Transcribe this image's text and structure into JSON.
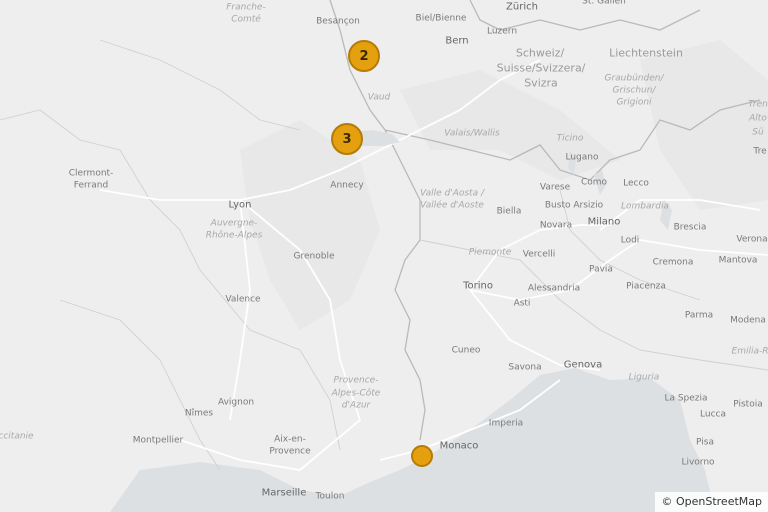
{
  "map": {
    "labels": [
      {
        "id": "franche-comte-1",
        "text": "Franche-",
        "kind": "region"
      },
      {
        "id": "franche-comte-2",
        "text": "Comté",
        "kind": "region"
      },
      {
        "id": "besancon",
        "text": "Besançon",
        "kind": "city"
      },
      {
        "id": "biel",
        "text": "Biel/Bienne",
        "kind": "city"
      },
      {
        "id": "bern",
        "text": "Bern",
        "kind": "big"
      },
      {
        "id": "zurich",
        "text": "Zürich",
        "kind": "big"
      },
      {
        "id": "st-gallen",
        "text": "St. Gallen",
        "kind": "city"
      },
      {
        "id": "luzern",
        "text": "Luzern",
        "kind": "city"
      },
      {
        "id": "liechtenstein",
        "text": "Liechtenstein",
        "kind": "country"
      },
      {
        "id": "schweiz-1",
        "text": "Schweiz/",
        "kind": "country"
      },
      {
        "id": "schweiz-2",
        "text": "Suisse/Svizzera/",
        "kind": "country"
      },
      {
        "id": "schweiz-3",
        "text": "Svizra",
        "kind": "country"
      },
      {
        "id": "graubunden-1",
        "text": "Graubünden/",
        "kind": "region"
      },
      {
        "id": "graubunden-2",
        "text": "Grischun/",
        "kind": "region"
      },
      {
        "id": "graubunden-3",
        "text": "Grigioni",
        "kind": "region"
      },
      {
        "id": "vaud",
        "text": "Vaud",
        "kind": "region"
      },
      {
        "id": "valais",
        "text": "Valais/Wallis",
        "kind": "region"
      },
      {
        "id": "ticino",
        "text": "Ticino",
        "kind": "region"
      },
      {
        "id": "trentino-1",
        "text": "Tren",
        "kind": "region"
      },
      {
        "id": "trentino-2",
        "text": "Alto",
        "kind": "region"
      },
      {
        "id": "trentino-3",
        "text": "Sü",
        "kind": "region"
      },
      {
        "id": "trento",
        "text": "Tre",
        "kind": "city"
      },
      {
        "id": "clermont-1",
        "text": "Clermont-",
        "kind": "city"
      },
      {
        "id": "clermont-2",
        "text": "Ferrand",
        "kind": "city"
      },
      {
        "id": "annecy",
        "text": "Annecy",
        "kind": "city"
      },
      {
        "id": "lugano",
        "text": "Lugano",
        "kind": "city"
      },
      {
        "id": "como",
        "text": "Como",
        "kind": "city"
      },
      {
        "id": "lecco",
        "text": "Lecco",
        "kind": "city"
      },
      {
        "id": "varese",
        "text": "Varese",
        "kind": "city"
      },
      {
        "id": "lyon",
        "text": "Lyon",
        "kind": "big"
      },
      {
        "id": "valle-aosta-1",
        "text": "Valle d'Aosta /",
        "kind": "region"
      },
      {
        "id": "valle-aosta-2",
        "text": "Vallée d'Aoste",
        "kind": "region"
      },
      {
        "id": "biella",
        "text": "Biella",
        "kind": "city"
      },
      {
        "id": "busto",
        "text": "Busto Arsizio",
        "kind": "city"
      },
      {
        "id": "lombardia",
        "text": "Lombardia",
        "kind": "region"
      },
      {
        "id": "auvergne-1",
        "text": "Auvergne-",
        "kind": "region"
      },
      {
        "id": "auvergne-2",
        "text": "Rhône-Alpes",
        "kind": "region"
      },
      {
        "id": "novara",
        "text": "Novara",
        "kind": "city"
      },
      {
        "id": "milano",
        "text": "Milano",
        "kind": "big"
      },
      {
        "id": "brescia",
        "text": "Brescia",
        "kind": "city"
      },
      {
        "id": "verona",
        "text": "Verona",
        "kind": "city"
      },
      {
        "id": "lodi",
        "text": "Lodi",
        "kind": "city"
      },
      {
        "id": "grenoble",
        "text": "Grenoble",
        "kind": "city"
      },
      {
        "id": "piemonte",
        "text": "Piemonte",
        "kind": "region"
      },
      {
        "id": "vercelli",
        "text": "Vercelli",
        "kind": "city"
      },
      {
        "id": "cremona",
        "text": "Cremona",
        "kind": "city"
      },
      {
        "id": "mantova",
        "text": "Mantova",
        "kind": "city"
      },
      {
        "id": "pavia",
        "text": "Pavia",
        "kind": "city"
      },
      {
        "id": "torino",
        "text": "Torino",
        "kind": "big"
      },
      {
        "id": "alessandria",
        "text": "Alessandria",
        "kind": "city"
      },
      {
        "id": "piacenza",
        "text": "Piacenza",
        "kind": "city"
      },
      {
        "id": "valence",
        "text": "Valence",
        "kind": "city"
      },
      {
        "id": "asti",
        "text": "Asti",
        "kind": "city"
      },
      {
        "id": "parma",
        "text": "Parma",
        "kind": "city"
      },
      {
        "id": "modena",
        "text": "Modena",
        "kind": "city"
      },
      {
        "id": "emilia",
        "text": "Emilia-R",
        "kind": "region"
      },
      {
        "id": "cuneo",
        "text": "Cuneo",
        "kind": "city"
      },
      {
        "id": "savona",
        "text": "Savona",
        "kind": "city"
      },
      {
        "id": "genova",
        "text": "Genova",
        "kind": "big"
      },
      {
        "id": "provence-1",
        "text": "Provence-",
        "kind": "region"
      },
      {
        "id": "provence-2",
        "text": "Alpes-Côte",
        "kind": "region"
      },
      {
        "id": "provence-3",
        "text": "d'Azur",
        "kind": "region"
      },
      {
        "id": "liguria",
        "text": "Liguria",
        "kind": "region"
      },
      {
        "id": "avignon",
        "text": "Avignon",
        "kind": "city"
      },
      {
        "id": "la-spezia",
        "text": "La Spezia",
        "kind": "city"
      },
      {
        "id": "pistoia",
        "text": "Pistoia",
        "kind": "city"
      },
      {
        "id": "nimes",
        "text": "Nîmes",
        "kind": "city"
      },
      {
        "id": "lucca",
        "text": "Lucca",
        "kind": "city"
      },
      {
        "id": "imperia",
        "text": "Imperia",
        "kind": "city"
      },
      {
        "id": "occitanie",
        "text": "ccitanie",
        "kind": "region"
      },
      {
        "id": "montpellier",
        "text": "Montpellier",
        "kind": "city"
      },
      {
        "id": "aix-1",
        "text": "Aix-en-",
        "kind": "city"
      },
      {
        "id": "aix-2",
        "text": "Provence",
        "kind": "city"
      },
      {
        "id": "monaco",
        "text": "Monaco",
        "kind": "big"
      },
      {
        "id": "pisa",
        "text": "Pisa",
        "kind": "city"
      },
      {
        "id": "livorno",
        "text": "Livorno",
        "kind": "city"
      },
      {
        "id": "marseille",
        "text": "Marseille",
        "kind": "big"
      },
      {
        "id": "toulon",
        "text": "Toulon",
        "kind": "city"
      }
    ],
    "markers": [
      {
        "id": "cluster-2",
        "count": "2",
        "type": "cluster"
      },
      {
        "id": "cluster-3",
        "count": "3",
        "type": "cluster"
      },
      {
        "id": "single-nice",
        "count": "",
        "type": "single"
      }
    ],
    "colors": {
      "marker_fill": "#e4a00e",
      "marker_border": "#b47c06",
      "sea": "#dde0e3",
      "land": "#eeeeee",
      "border": "#b9b9b9",
      "road": "#ffffff"
    },
    "attribution": "© OpenStreetMap"
  }
}
